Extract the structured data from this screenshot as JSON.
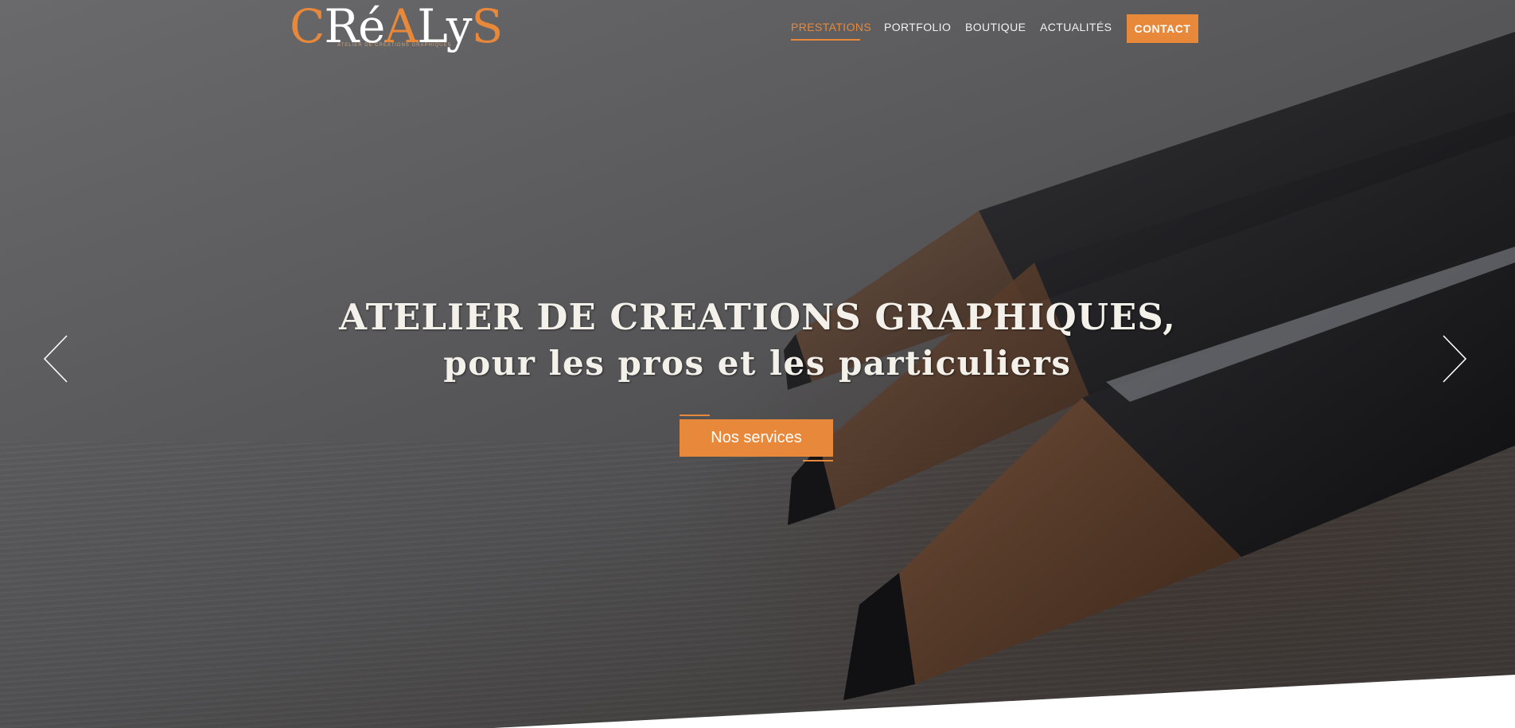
{
  "brand": {
    "logo_parts": [
      "C",
      "Ré",
      "A",
      "Ly",
      "S"
    ],
    "tagline": "ATELIER DE CRÉATIONS GRAPHIQUES"
  },
  "nav": {
    "items": [
      {
        "label": "PRESTATIONS",
        "active": true
      },
      {
        "label": "PORTFOLIO",
        "active": false
      },
      {
        "label": "BOUTIQUE",
        "active": false
      },
      {
        "label": "ACTUALITÉS",
        "active": false
      }
    ],
    "contact_label": "CONTACT"
  },
  "hero": {
    "headline_line1": "ATELIER DE CREATIONS GRAPHIQUES,",
    "headline_line2": "pour les pros et les particuliers",
    "cta_label": "Nos services",
    "prev_icon": "chevron-left-icon",
    "next_icon": "chevron-right-icon"
  },
  "colors": {
    "accent": "#e8883a",
    "text_light": "#f4f0ea",
    "overlay": "#5a5a5c"
  }
}
